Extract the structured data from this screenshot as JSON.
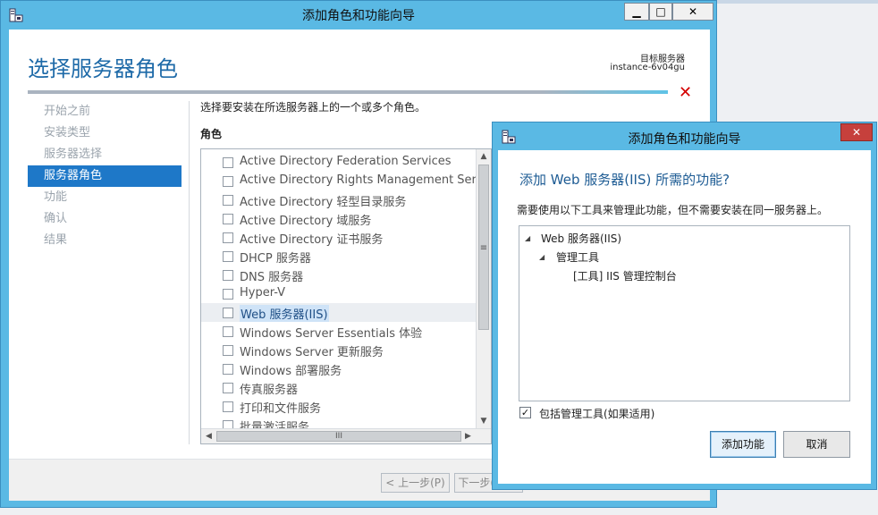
{
  "main_window": {
    "title": "添加角色和功能向导",
    "controls": {
      "minimize": "▁",
      "maximize": "□",
      "close": "✕"
    },
    "page_title": "选择服务器角色",
    "target_server_label": "目标服务器",
    "target_server_name": "instance-6v04gu",
    "nav": [
      {
        "label": "开始之前",
        "active": false
      },
      {
        "label": "安装类型",
        "active": false
      },
      {
        "label": "服务器选择",
        "active": false
      },
      {
        "label": "服务器角色",
        "active": true
      },
      {
        "label": "功能",
        "active": false
      },
      {
        "label": "确认",
        "active": false
      },
      {
        "label": "结果",
        "active": false
      }
    ],
    "description": "选择要安装在所选服务器上的一个或多个角色。",
    "roles_header": "角色",
    "roles": [
      {
        "label": "Active Directory Federation Services",
        "checked": false,
        "selected": false
      },
      {
        "label": "Active Directory Rights Management Services",
        "checked": false,
        "selected": false
      },
      {
        "label": "Active Directory 轻型目录服务",
        "checked": false,
        "selected": false
      },
      {
        "label": "Active Directory 域服务",
        "checked": false,
        "selected": false
      },
      {
        "label": "Active Directory 证书服务",
        "checked": false,
        "selected": false
      },
      {
        "label": "DHCP 服务器",
        "checked": false,
        "selected": false
      },
      {
        "label": "DNS 服务器",
        "checked": false,
        "selected": false
      },
      {
        "label": "Hyper-V",
        "checked": false,
        "selected": false
      },
      {
        "label": "Web 服务器(IIS)",
        "checked": false,
        "selected": true
      },
      {
        "label": "Windows Server Essentials 体验",
        "checked": false,
        "selected": false
      },
      {
        "label": "Windows Server 更新服务",
        "checked": false,
        "selected": false
      },
      {
        "label": "Windows 部署服务",
        "checked": false,
        "selected": false
      },
      {
        "label": "传真服务器",
        "checked": false,
        "selected": false
      },
      {
        "label": "打印和文件服务",
        "checked": false,
        "selected": false
      },
      {
        "label": "批量激活服务",
        "checked": false,
        "selected": false
      }
    ],
    "prev_button": "< 上一步(P)",
    "next_button": "下一步(N) >",
    "error_icon": "red-x-icon"
  },
  "dialog": {
    "title": "添加角色和功能向导",
    "close": "✕",
    "heading": "添加 Web 服务器(IIS) 所需的功能?",
    "description": "需要使用以下工具来管理此功能，但不需要安装在同一服务器上。",
    "tree": {
      "root": "Web 服务器(IIS)",
      "child": "管理工具",
      "leaf": "[工具] IIS 管理控制台"
    },
    "include_tools_label": "包括管理工具(如果适用)",
    "include_tools_checked": true,
    "add_button": "添加功能",
    "cancel_button": "取消"
  },
  "colors": {
    "accent": "#1e78c8",
    "title_bar": "#5ab9e4",
    "error": "#d40000",
    "close_red": "#c6403c"
  }
}
